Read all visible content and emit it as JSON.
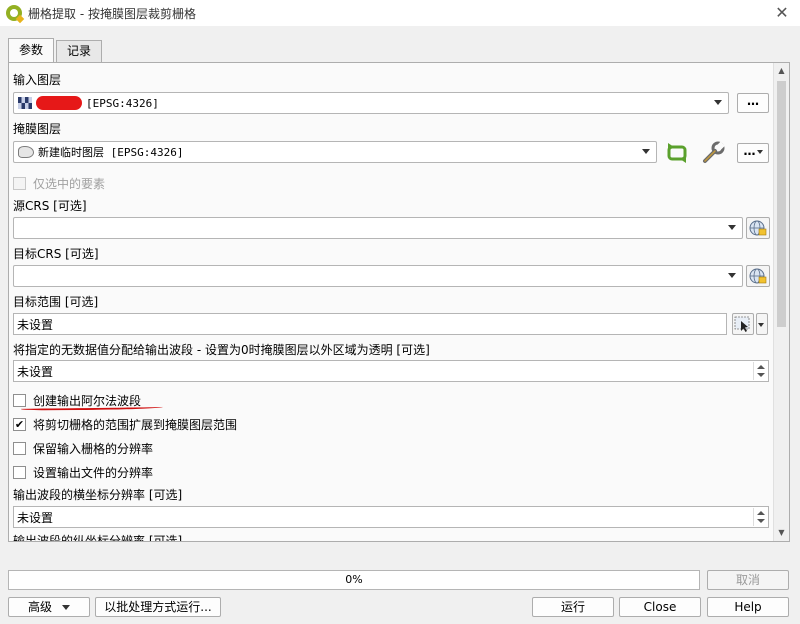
{
  "window": {
    "title": "栅格提取 - 按掩膜图层裁剪栅格",
    "close_glyph": "✕"
  },
  "tabs": [
    {
      "label": "参数"
    },
    {
      "label": "记录"
    }
  ],
  "params": {
    "input_layer": {
      "label": "输入图层",
      "value": "[EPSG:4326]",
      "button": "…"
    },
    "mask_layer": {
      "label": "掩膜图层",
      "value": "新建临时图层 [EPSG:4326]",
      "button": "…"
    },
    "selected_only": {
      "label": "仅选中的要素",
      "checked": false
    },
    "source_crs": {
      "label": "源CRS [可选]",
      "value": ""
    },
    "target_crs": {
      "label": "目标CRS [可选]",
      "value": ""
    },
    "target_extent": {
      "label": "目标范围 [可选]",
      "value": "未设置"
    },
    "nodata": {
      "label": "将指定的无数据值分配给输出波段 - 设置为0时掩膜图层以外区域为透明 [可选]",
      "value": "未设置"
    },
    "create_alpha": {
      "label": "创建输出阿尔法波段",
      "checked": false
    },
    "crop_to_cutline": {
      "label": "将剪切栅格的范围扩展到掩膜图层范围",
      "checked": true
    },
    "keep_resolution": {
      "label": "保留输入栅格的分辨率",
      "checked": false
    },
    "set_resolution": {
      "label": "设置输出文件的分辨率",
      "checked": false
    },
    "x_res": {
      "label": "输出波段的横坐标分辨率 [可选]",
      "value": "未设置"
    },
    "y_res": {
      "label": "输出波段的纵坐标分辨率 [可选]"
    }
  },
  "icons": {
    "checkmark": "✔",
    "accent_green": "#5aa02c",
    "redaction_color": "#e61818"
  },
  "progress": {
    "text": "0%",
    "value": 0
  },
  "footer": {
    "cancel": "取消",
    "advanced": "高级",
    "batch": "以批处理方式运行...",
    "run": "运行",
    "close": "Close",
    "help": "Help"
  }
}
